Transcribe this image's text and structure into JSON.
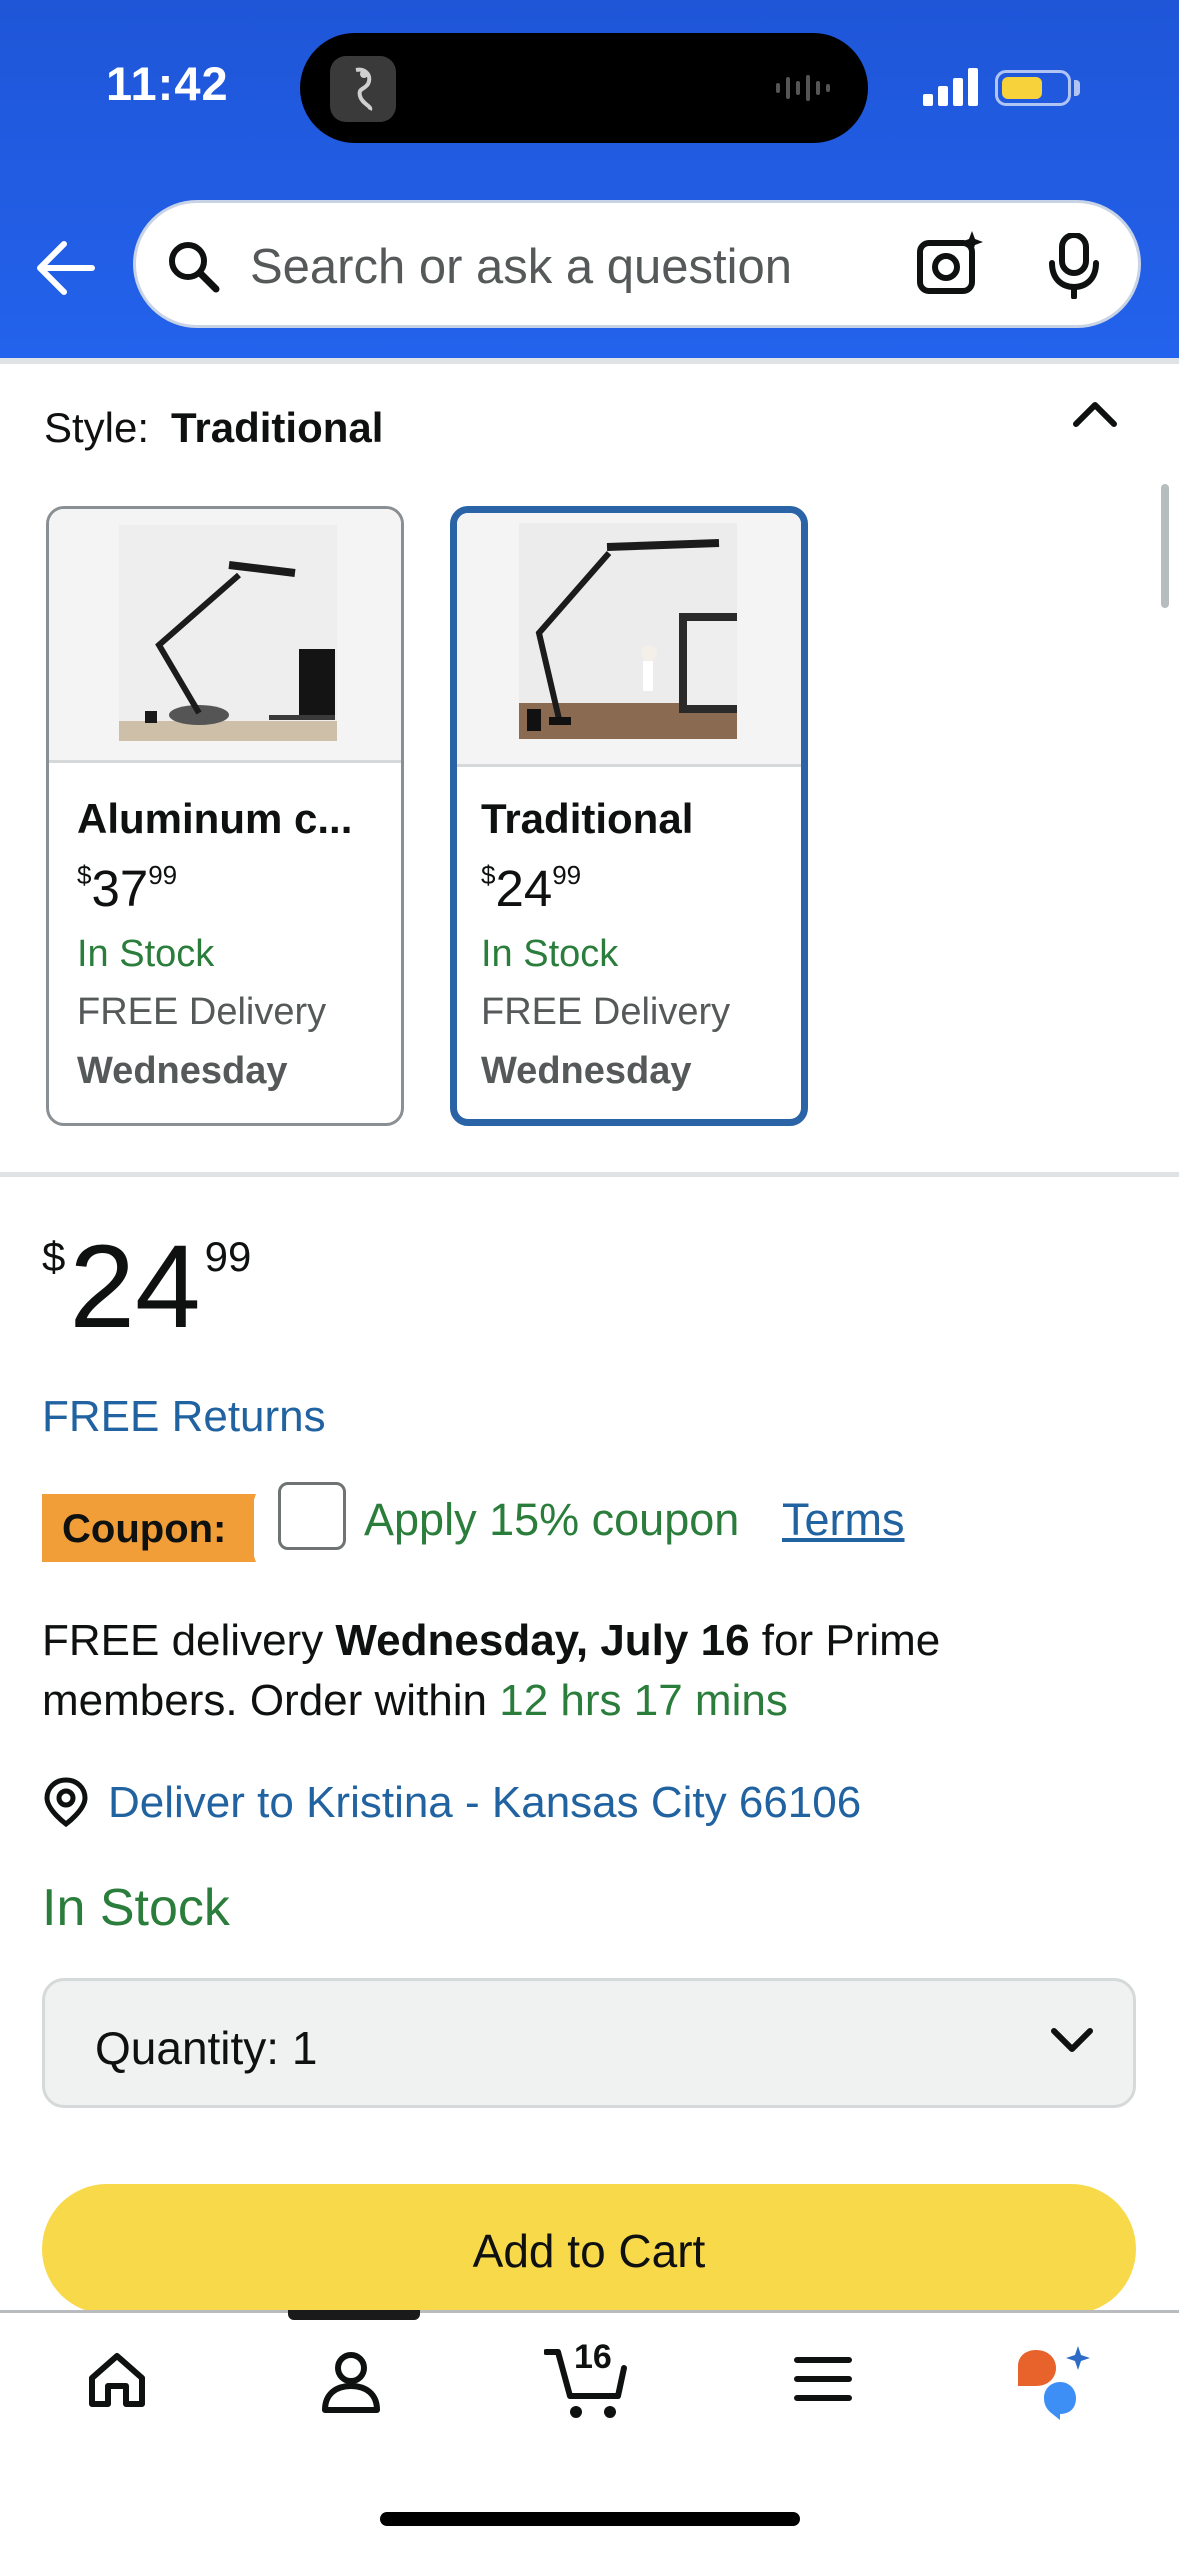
{
  "status_bar": {
    "time": "11:42"
  },
  "search": {
    "placeholder": "Search or ask a question"
  },
  "style_selector": {
    "label": "Style:",
    "selected_value": "Traditional",
    "options": [
      {
        "title": "Aluminum c...",
        "price_dollars": "37",
        "price_cents": "99",
        "currency": "$",
        "stock": "In Stock",
        "delivery": "FREE Delivery",
        "day": "Wednesday",
        "selected": false
      },
      {
        "title": "Traditional",
        "price_dollars": "24",
        "price_cents": "99",
        "currency": "$",
        "stock": "In Stock",
        "delivery": "FREE Delivery",
        "day": "Wednesday",
        "selected": true
      }
    ]
  },
  "buy_box": {
    "currency": "$",
    "price_dollars": "24",
    "price_cents": "99",
    "free_returns": "FREE Returns",
    "coupon_tag": "Coupon:",
    "coupon_text": "Apply 15% coupon",
    "terms": "Terms",
    "delivery_prefix": "FREE delivery ",
    "delivery_date": "Wednesday, July 16",
    "delivery_suffix": " for Prime",
    "delivery_line2_prefix": "members. Order within ",
    "order_within": "12 hrs 17 mins",
    "deliver_to": "Deliver to Kristina - Kansas City 66106",
    "stock_status": "In Stock",
    "quantity_label": "Quantity:",
    "quantity_value": "1",
    "add_to_cart": "Add to Cart"
  },
  "bottom_nav": {
    "items": [
      "home-icon",
      "account-icon",
      "cart-icon",
      "menu-icon",
      "rufus-icon"
    ],
    "cart_count": "16"
  },
  "colors": {
    "header_blue": "#2362ec",
    "link_blue": "#2162a1",
    "stock_green": "#2a7d3b",
    "coupon_orange": "#f19e38",
    "cart_yellow": "#f8d94a",
    "selected_border": "#2a63a6"
  }
}
